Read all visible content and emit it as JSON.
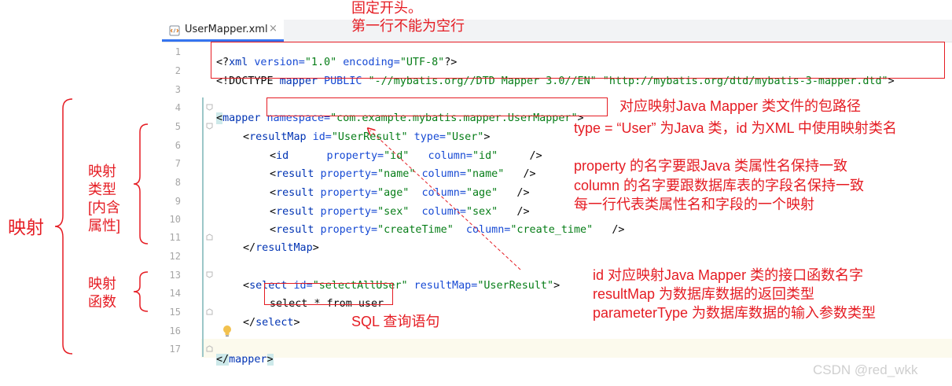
{
  "tab": {
    "filename": "UserMapper.xml",
    "close": "×",
    "icon": "xml-file-icon"
  },
  "lines": [
    {
      "n": "1"
    },
    {
      "n": "2"
    },
    {
      "n": "3"
    },
    {
      "n": "4"
    },
    {
      "n": "5"
    },
    {
      "n": "6"
    },
    {
      "n": "7"
    },
    {
      "n": "8"
    },
    {
      "n": "9"
    },
    {
      "n": "10"
    },
    {
      "n": "11"
    },
    {
      "n": "12"
    },
    {
      "n": "13"
    },
    {
      "n": "14"
    },
    {
      "n": "15"
    },
    {
      "n": "16"
    },
    {
      "n": "17"
    }
  ],
  "code": {
    "l1": {
      "p1": "<?",
      "tag": "xml",
      "a1": " version=",
      "v1": "\"1.0\"",
      "a2": " encoding=",
      "v2": "\"UTF-8\"",
      "p2": "?>"
    },
    "l2": {
      "p1": "<!DOCTYPE ",
      "tag": "mapper",
      "a1": " PUBLIC ",
      "v1": "\"-//mybatis.org//DTD Mapper 3.0//EN\"",
      "v2": " \"http://mybatis.org/dtd/mybatis-3-mapper.dtd\"",
      "p2": ">"
    },
    "l4": {
      "p1": "<",
      "tag": "mapper",
      "a1": " namespace=",
      "v1": "\"com.example.mybatis.mapper.UserMapper\"",
      "p2": ">"
    },
    "l5": {
      "p1": "<",
      "tag": "resultMap",
      "a1": " id=",
      "v1": "\"UserResult\"",
      "a2": " type=",
      "v2": "\"User\"",
      "p2": ">"
    },
    "l6": {
      "p1": "<",
      "tag": "id",
      "a1": "      property=",
      "v1": "\"id\"",
      "a2": "   column=",
      "v2": "\"id\"",
      "p2": "     />"
    },
    "l7": {
      "p1": "<",
      "tag": "result",
      "a1": " property=",
      "v1": "\"name\"",
      "a2": " column=",
      "v2": "\"name\"",
      "p2": "   />"
    },
    "l8": {
      "p1": "<",
      "tag": "result",
      "a1": " property=",
      "v1": "\"age\"",
      "a2": "  column=",
      "v2": "\"age\"",
      "p2": "   />"
    },
    "l9": {
      "p1": "<",
      "tag": "result",
      "a1": " property=",
      "v1": "\"sex\"",
      "a2": "  column=",
      "v2": "\"sex\"",
      "p2": "   />"
    },
    "l10": {
      "p1": "<",
      "tag": "result",
      "a1": " property=",
      "v1": "\"createTime\"",
      "a2": "  column=",
      "v2": "\"create_time\"",
      "p2": "   />"
    },
    "l11": {
      "p1": "</",
      "tag": "resultMap",
      "p2": ">"
    },
    "l13": {
      "p1": "<",
      "tag": "select",
      "a1": " id=",
      "v1": "\"selectAllUser\"",
      "a2": " resultMap=",
      "v2": "\"UserResult\"",
      "p2": ">"
    },
    "l14": {
      "sql": "select * from user"
    },
    "l15": {
      "p1": "</",
      "tag": "select",
      "p2": ">"
    },
    "l17": {
      "p1": "</",
      "tag": "mapper",
      "p2": ">"
    }
  },
  "annotations": {
    "header1": "固定开头。",
    "header2": "第一行不能为空行",
    "namespace": "对应映射Java Mapper 类文件的包路径",
    "type": "type = “User” 为Java 类，id 为XML 中使用映射类名",
    "prop1": "property 的名字要跟Java 类属性名保持一致",
    "prop2": "column 的名字要跟数据库表的字段名保持一致",
    "prop3": "每一行代表类属性名和字段的一个映射",
    "select1": "id 对应映射Java Mapper 类的接口函数名字",
    "select2": "resultMap 为数据库数据的返回类型",
    "select3": "parameterType 为数据库数据的输入参数类型",
    "sql": "SQL 查询语句",
    "mapping": "映射",
    "mapping_type": [
      "映射",
      "类型",
      "[内含",
      "属性]"
    ],
    "mapping_func": [
      "映射",
      "函数"
    ]
  },
  "watermark": "CSDN @red_wkk",
  "colors": {
    "annotation": "#e51c23",
    "tag": "#0033b3",
    "attr": "#174ad4",
    "value": "#067d17",
    "tab_accent": "#3574f0"
  }
}
